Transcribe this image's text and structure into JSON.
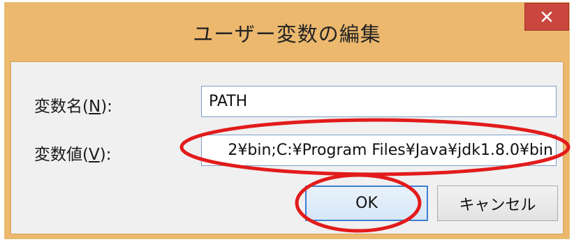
{
  "window": {
    "title": "ユーザー変数の編集",
    "close_icon": "close-icon"
  },
  "form": {
    "name_label_pre": "変数名(",
    "name_label_key": "N",
    "name_label_post": "):",
    "name_value": "PATH",
    "value_label_pre": "変数値(",
    "value_label_key": "V",
    "value_label_post": "):",
    "value_value": "2¥bin;C:¥Program Files¥Java¥jdk1.8.0¥bin"
  },
  "buttons": {
    "ok": "OK",
    "cancel": "キャンセル"
  },
  "colors": {
    "title_bar": "#ecb86e",
    "close_button": "#c9473f",
    "annotation": "#e21b1b",
    "focus_border": "#3c7fd1"
  }
}
